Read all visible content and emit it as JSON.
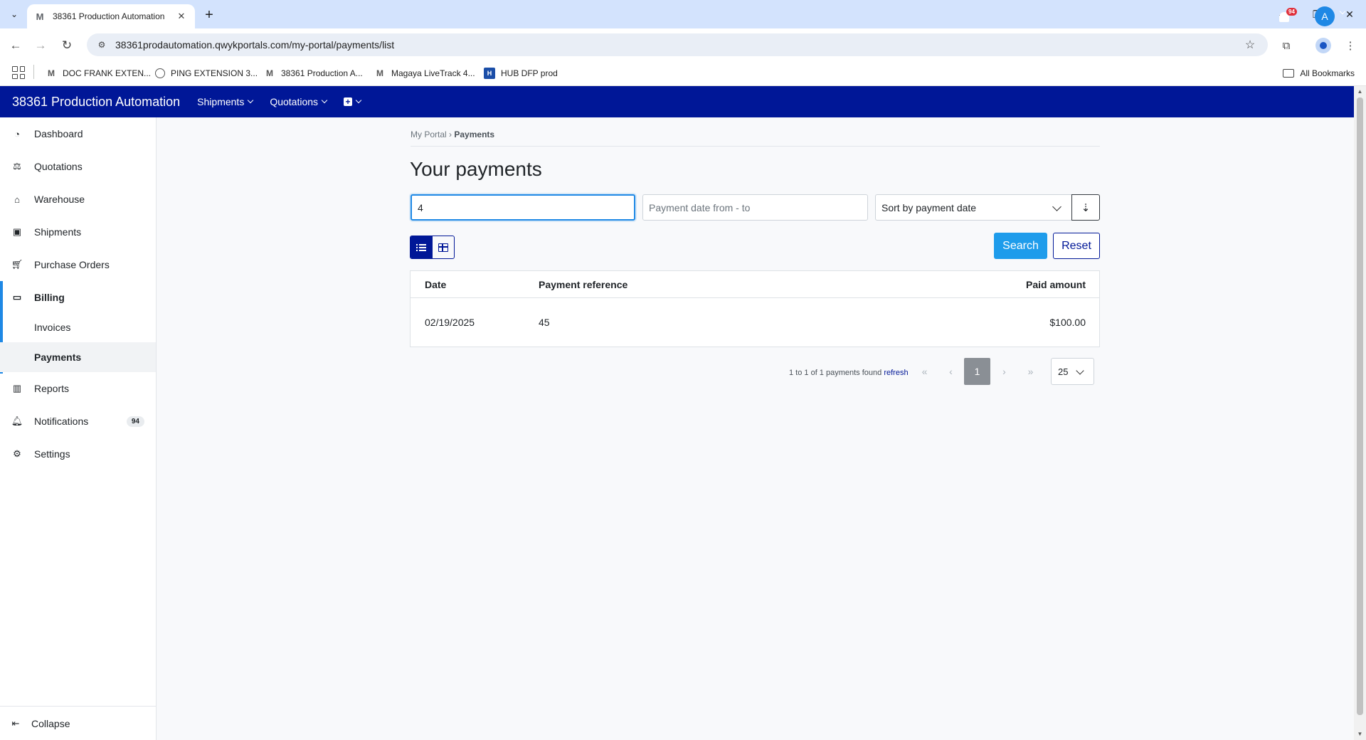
{
  "browser": {
    "tab_title": "38361 Production Automation",
    "tab_favicon": "M",
    "url": "38361prodautomation.qwykportals.com/my-portal/payments/list",
    "bookmarks": [
      {
        "label": "DOC FRANK EXTEN...",
        "icon": "M"
      },
      {
        "label": "PING EXTENSION 3...",
        "icon": ""
      },
      {
        "label": "38361 Production A...",
        "icon": "M"
      },
      {
        "label": "Magaya LiveTrack 4...",
        "icon": "M"
      },
      {
        "label": "HUB DFP prod",
        "icon": "HUB"
      }
    ],
    "all_bookmarks": "All Bookmarks"
  },
  "header": {
    "title": "38361 Production Automation",
    "menus": [
      "Shipments",
      "Quotations"
    ],
    "notification_count": "94",
    "avatar_initial": "A",
    "color": "#001797"
  },
  "sidebar": {
    "items": [
      {
        "label": "Dashboard",
        "icon": "gauge-icon"
      },
      {
        "label": "Quotations",
        "icon": "quotations-icon"
      },
      {
        "label": "Warehouse",
        "icon": "warehouse-icon"
      },
      {
        "label": "Shipments",
        "icon": "box-icon"
      },
      {
        "label": "Purchase Orders",
        "icon": "cart-icon"
      },
      {
        "label": "Billing",
        "icon": "credit-card-icon"
      },
      {
        "label": "Reports",
        "icon": "bar-chart-icon"
      },
      {
        "label": "Notifications",
        "icon": "bell-icon",
        "badge": "94"
      },
      {
        "label": "Settings",
        "icon": "gear-icon"
      }
    ],
    "billing_sub": [
      "Invoices",
      "Payments"
    ],
    "collapse": "Collapse"
  },
  "main": {
    "breadcrumb_root": "My Portal",
    "breadcrumb_sep": "›",
    "breadcrumb_current": "Payments",
    "title": "Your payments",
    "search_value": "4",
    "date_placeholder": "Payment date from - to",
    "sort_label": "Sort by payment date",
    "search_button": "Search",
    "reset_button": "Reset",
    "table": {
      "headers": [
        "Date",
        "Payment reference",
        "Paid amount"
      ],
      "rows": [
        [
          "02/19/2025",
          "45",
          "$100.00"
        ]
      ]
    },
    "pager": {
      "info": "1 to 1 of 1 payments found",
      "refresh": "refresh",
      "current_page": "1",
      "page_size": "25"
    }
  },
  "accent_color": "#1e88e5"
}
